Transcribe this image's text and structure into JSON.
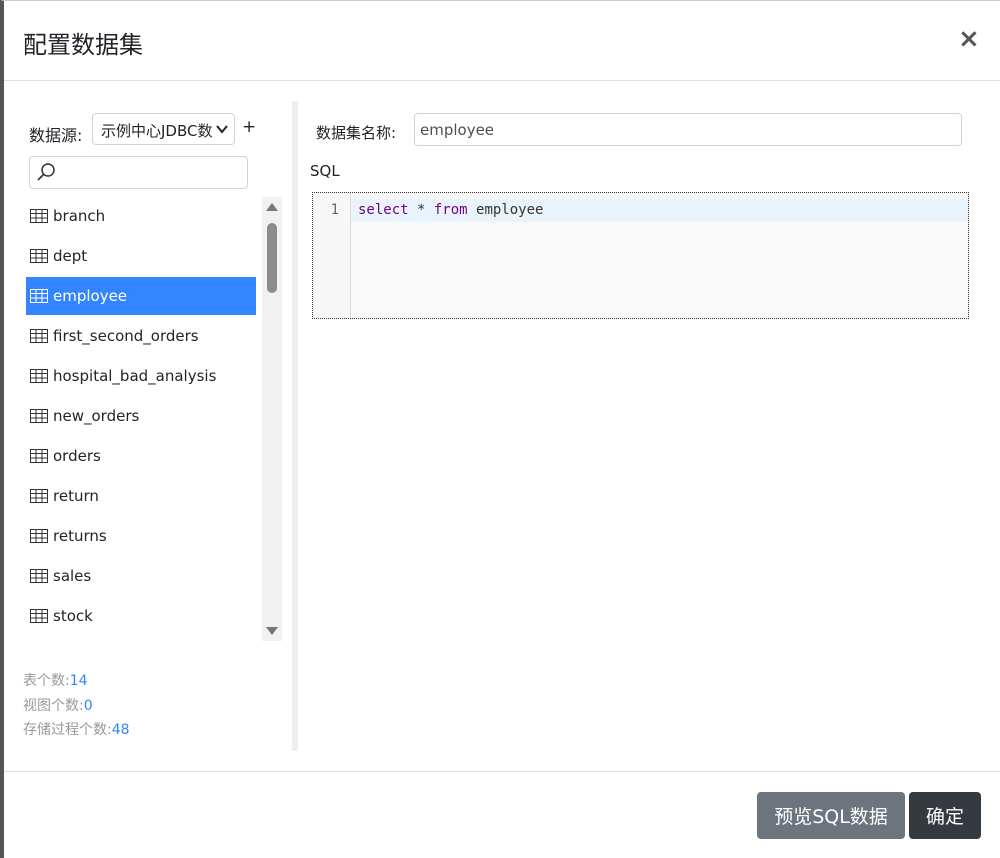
{
  "modal": {
    "title": "配置数据集",
    "close_label": "×"
  },
  "datasource": {
    "label": "数据源:",
    "selected": "示例中心JDBC数",
    "add_label": "+"
  },
  "search": {
    "placeholder": ""
  },
  "tables": [
    {
      "label": "branch",
      "selected": false
    },
    {
      "label": "dept",
      "selected": false
    },
    {
      "label": "employee",
      "selected": true
    },
    {
      "label": "first_second_orders",
      "selected": false
    },
    {
      "label": "hospital_bad_analysis",
      "selected": false
    },
    {
      "label": "new_orders",
      "selected": false
    },
    {
      "label": "orders",
      "selected": false
    },
    {
      "label": "return",
      "selected": false
    },
    {
      "label": "returns",
      "selected": false
    },
    {
      "label": "sales",
      "selected": false
    },
    {
      "label": "stock",
      "selected": false
    }
  ],
  "stats": {
    "tables_label": "表个数:",
    "tables_count": "14",
    "views_label": "视图个数:",
    "views_count": "0",
    "procs_label": "存储过程个数:",
    "procs_count": "48"
  },
  "dataset": {
    "name_label": "数据集名称:",
    "name_value": "employee",
    "sql_label": "SQL",
    "line_number": "1",
    "sql_keyword_select": "select",
    "sql_star": " * ",
    "sql_keyword_from": "from",
    "sql_table": " employee"
  },
  "footer": {
    "preview_label": "预览SQL数据",
    "ok_label": "确定"
  },
  "colors": {
    "accent": "#3385ff",
    "keyword": "#770088",
    "preview_button": "#6c757d",
    "ok_button": "#343a40"
  }
}
